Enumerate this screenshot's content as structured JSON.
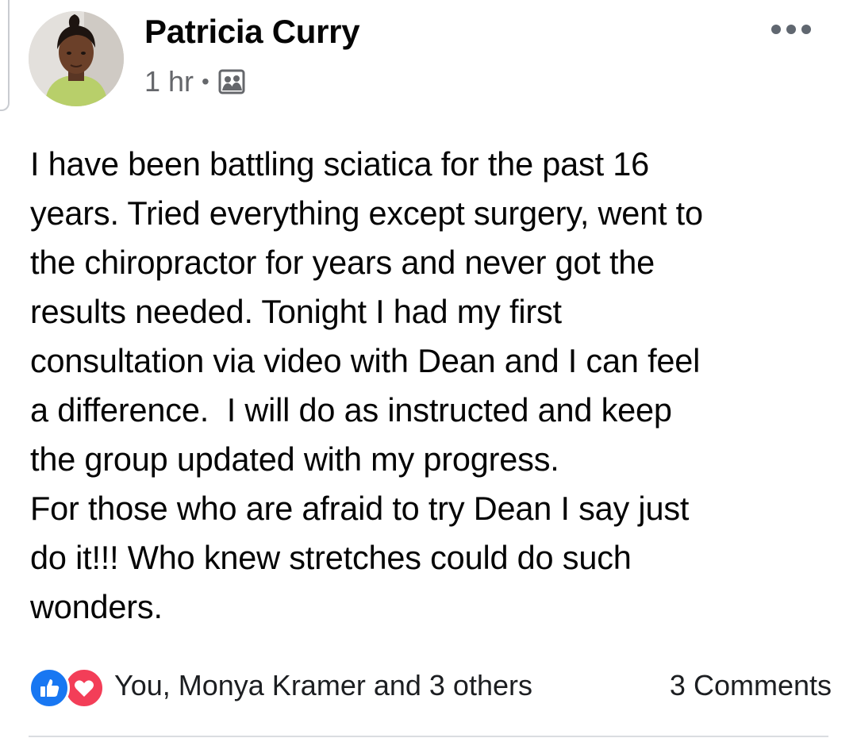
{
  "post": {
    "author": "Patricia Curry",
    "time": "1 hr",
    "separator": "•",
    "audience_icon": "group-icon",
    "body": "I have been battling sciatica for the past 16\nyears. Tried everything except surgery, went to\nthe chiropractor for years and never got the\nresults needed. Tonight I had my first\nconsultation via video with Dean and I can feel\na difference.  I will do as instructed and keep\nthe group updated with my progress.\nFor those who are afraid to try Dean I say just\ndo it!!! Who knew stretches could do such\nwonders."
  },
  "reactions": {
    "icons": [
      "like-icon",
      "love-icon"
    ],
    "summary": "You, Monya Kramer and 3 others",
    "comments": "3 Comments"
  },
  "colors": {
    "like": "#1877f2",
    "love": "#f33e58",
    "secondary_text": "#65676b"
  }
}
